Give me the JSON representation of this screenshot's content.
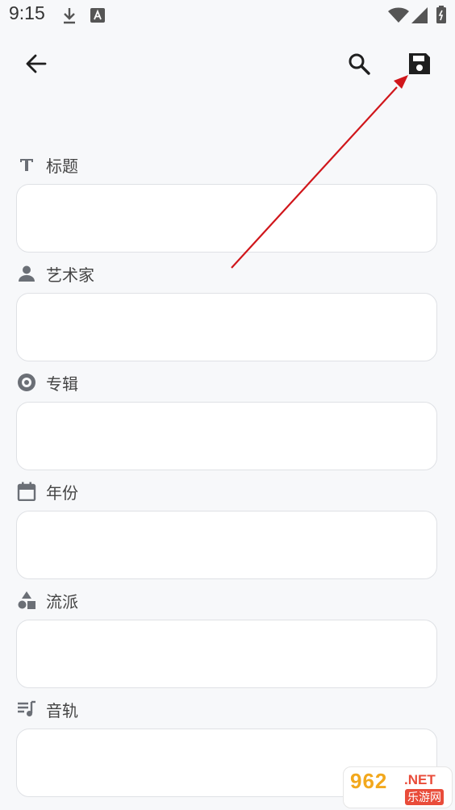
{
  "status_bar": {
    "time": "9:15",
    "icons": [
      "download-icon",
      "a-notification-icon",
      "wifi-icon",
      "signal-icon",
      "battery-icon"
    ]
  },
  "app_bar": {
    "icons": [
      "back-arrow-icon",
      "search-icon",
      "save-icon"
    ]
  },
  "fields": [
    {
      "label": "标题",
      "icon": "text-icon",
      "value": ""
    },
    {
      "label": "艺术家",
      "icon": "person-icon",
      "value": ""
    },
    {
      "label": "专辑",
      "icon": "album-disc-icon",
      "value": ""
    },
    {
      "label": "年份",
      "icon": "calendar-icon",
      "value": ""
    },
    {
      "label": "流派",
      "icon": "genre-shapes-icon",
      "value": ""
    },
    {
      "label": "音轨",
      "icon": "track-list-icon",
      "value": ""
    }
  ],
  "annotation": {
    "color": "#d0161b"
  },
  "watermark": {
    "number": "962",
    "suffix": ".NET",
    "site": "乐游网"
  },
  "colors": {
    "background": "#f7f8fa",
    "field_bg": "#ffffff",
    "field_border": "#dfe1e5",
    "icon": "#6b6f76"
  }
}
